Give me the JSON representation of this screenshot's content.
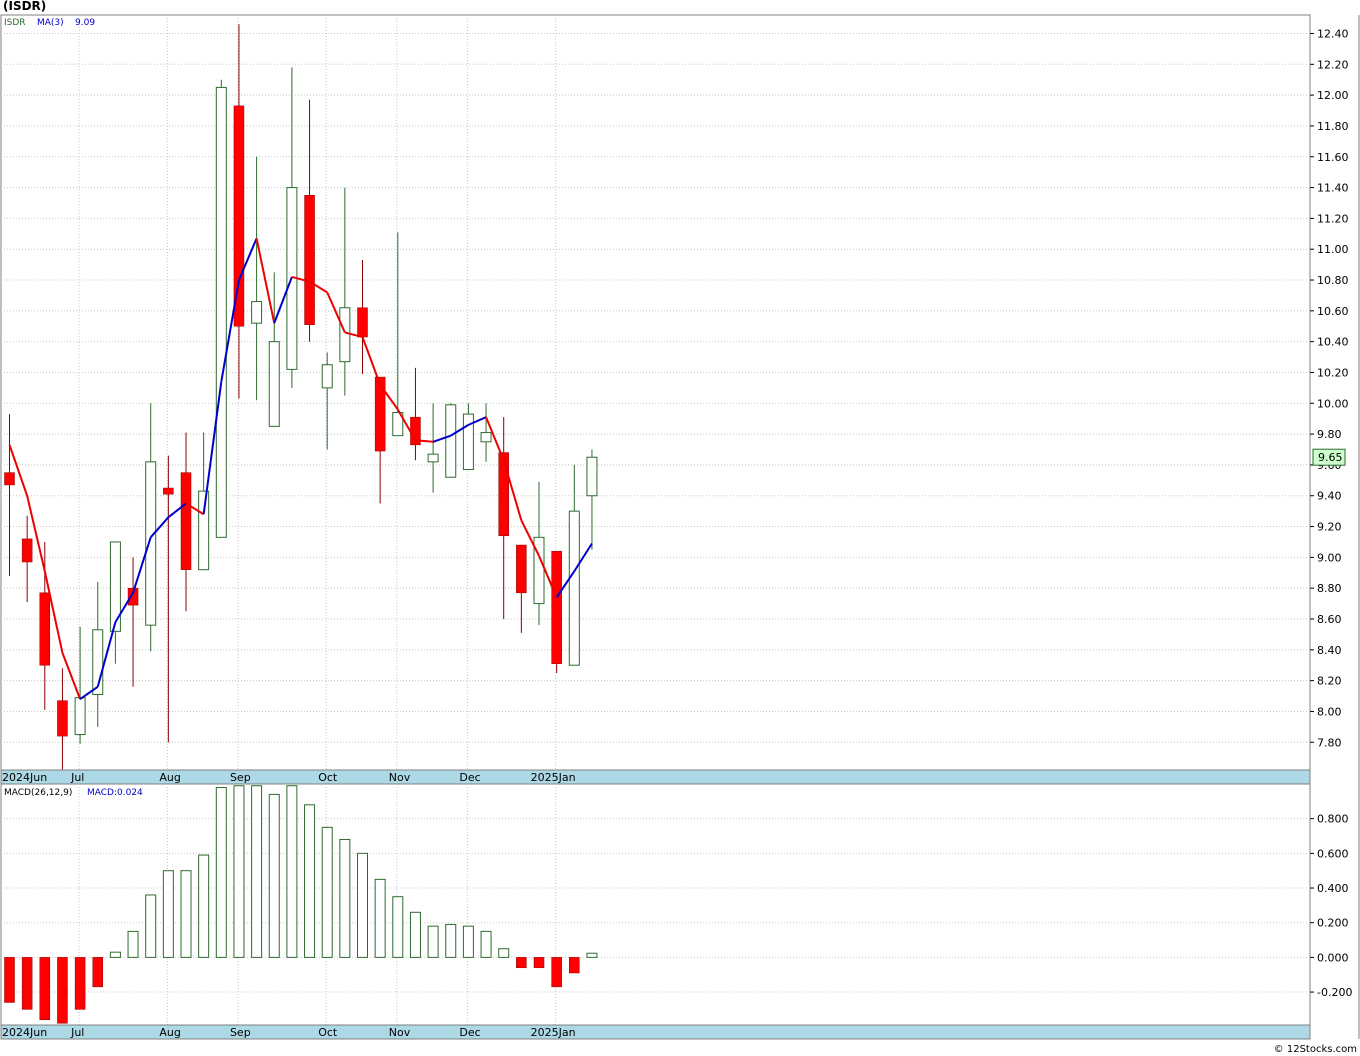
{
  "header": {
    "title": "(ISDR)"
  },
  "price_panel": {
    "symbol": "ISDR",
    "ma_label": "MA(3)",
    "ma_value": "9.09",
    "last_price_label": "9.65",
    "last_price": 9.65,
    "y_ticks": [
      "7.80",
      "8.00",
      "8.20",
      "8.40",
      "8.60",
      "8.80",
      "9.00",
      "9.20",
      "9.40",
      "9.60",
      "9.80",
      "10.00",
      "10.20",
      "10.40",
      "10.60",
      "10.80",
      "11.00",
      "11.20",
      "11.40",
      "11.60",
      "11.80",
      "12.00",
      "12.20",
      "12.40"
    ]
  },
  "macd_panel": {
    "label": "MACD(26,12,9)",
    "value_label": "MACD:0.024",
    "y_ticks": [
      "-0.200",
      "0.000",
      "0.200",
      "0.400",
      "0.600",
      "0.800"
    ]
  },
  "month_axis": {
    "labels": [
      {
        "text": "2024Jun",
        "week": 0
      },
      {
        "text": "Jul",
        "week": 4
      },
      {
        "text": "Aug",
        "week": 9
      },
      {
        "text": "Sep",
        "week": 13
      },
      {
        "text": "Oct",
        "week": 18
      },
      {
        "text": "Nov",
        "week": 22
      },
      {
        "text": "Dec",
        "week": 26
      },
      {
        "text": "2025Jan",
        "week": 31
      }
    ]
  },
  "footer": {
    "credit": "© 12Stocks.com"
  },
  "colors": {
    "up_candle": "#2e6b2e",
    "down_candle": "#ff0000",
    "ma_up": "#0000cc",
    "ma_down": "#ee0000",
    "axis_band": "#add8e6",
    "grid": "#c8c8c8",
    "last_price_bg": "#ccffcc"
  },
  "chart_data": {
    "type": "candlestick",
    "interval": "weekly",
    "price_ylim": [
      7.62,
      12.52
    ],
    "macd_ylim": [
      -0.39,
      1.0
    ],
    "candles": [
      {
        "o": 9.55,
        "h": 9.93,
        "l": 8.88,
        "c": 9.47
      },
      {
        "o": 9.12,
        "h": 9.27,
        "l": 8.71,
        "c": 8.97
      },
      {
        "o": 8.77,
        "h": 9.1,
        "l": 8.01,
        "c": 8.3
      },
      {
        "o": 8.07,
        "h": 8.28,
        "l": 7.62,
        "c": 7.84
      },
      {
        "o": 7.85,
        "h": 8.55,
        "l": 7.79,
        "c": 8.09
      },
      {
        "o": 8.11,
        "h": 8.84,
        "l": 7.9,
        "c": 8.53
      },
      {
        "o": 8.52,
        "h": 9.06,
        "l": 8.31,
        "c": 9.1
      },
      {
        "o": 8.8,
        "h": 9.0,
        "l": 8.16,
        "c": 8.69
      },
      {
        "o": 8.56,
        "h": 10.0,
        "l": 8.39,
        "c": 9.62
      },
      {
        "o": 9.45,
        "h": 9.66,
        "l": 7.8,
        "c": 9.41
      },
      {
        "o": 9.55,
        "h": 9.81,
        "l": 8.65,
        "c": 8.92
      },
      {
        "o": 8.92,
        "h": 9.81,
        "l": 8.92,
        "c": 9.43
      },
      {
        "o": 9.13,
        "h": 12.1,
        "l": 9.13,
        "c": 12.05
      },
      {
        "o": 11.93,
        "h": 12.46,
        "l": 10.03,
        "c": 10.5
      },
      {
        "o": 10.52,
        "h": 11.6,
        "l": 10.02,
        "c": 10.66
      },
      {
        "o": 9.85,
        "h": 10.85,
        "l": 9.85,
        "c": 10.4
      },
      {
        "o": 10.22,
        "h": 12.18,
        "l": 10.1,
        "c": 11.4
      },
      {
        "o": 11.35,
        "h": 11.97,
        "l": 10.4,
        "c": 10.51
      },
      {
        "o": 10.1,
        "h": 10.33,
        "l": 9.7,
        "c": 10.25
      },
      {
        "o": 10.27,
        "h": 11.4,
        "l": 10.05,
        "c": 10.62
      },
      {
        "o": 10.62,
        "h": 10.93,
        "l": 10.19,
        "c": 10.43
      },
      {
        "o": 10.17,
        "h": 10.17,
        "l": 9.35,
        "c": 9.69
      },
      {
        "o": 9.79,
        "h": 11.11,
        "l": 9.79,
        "c": 9.94
      },
      {
        "o": 9.91,
        "h": 10.23,
        "l": 9.63,
        "c": 9.73
      },
      {
        "o": 9.62,
        "h": 10.0,
        "l": 9.42,
        "c": 9.67
      },
      {
        "o": 9.52,
        "h": 10.0,
        "l": 9.52,
        "c": 9.99
      },
      {
        "o": 9.57,
        "h": 10.0,
        "l": 9.57,
        "c": 9.93
      },
      {
        "o": 9.75,
        "h": 10.0,
        "l": 9.62,
        "c": 9.81
      },
      {
        "o": 9.68,
        "h": 9.91,
        "l": 8.6,
        "c": 9.14
      },
      {
        "o": 9.08,
        "h": 9.08,
        "l": 8.51,
        "c": 8.77
      },
      {
        "o": 8.7,
        "h": 9.49,
        "l": 8.56,
        "c": 9.13
      },
      {
        "o": 9.04,
        "h": 9.04,
        "l": 8.25,
        "c": 8.31
      },
      {
        "o": 8.3,
        "h": 9.6,
        "l": 8.3,
        "c": 9.3
      },
      {
        "o": 9.4,
        "h": 9.7,
        "l": 9.05,
        "c": 9.65
      }
    ],
    "ma3": [
      9.73,
      9.4,
      8.91,
      8.38,
      8.08,
      8.16,
      8.58,
      8.77,
      9.13,
      9.26,
      9.35,
      9.28,
      10.14,
      10.8,
      11.07,
      10.52,
      10.82,
      10.79,
      10.72,
      10.46,
      10.43,
      10.12,
      9.96,
      9.76,
      9.75,
      9.79,
      9.86,
      9.91,
      9.63,
      9.24,
      9.01,
      8.74,
      8.91,
      9.09
    ],
    "macd_hist": [
      -0.26,
      -0.3,
      -0.36,
      -0.38,
      -0.3,
      -0.17,
      0.03,
      0.15,
      0.36,
      0.5,
      0.5,
      0.59,
      0.98,
      0.99,
      0.99,
      0.94,
      0.99,
      0.88,
      0.75,
      0.68,
      0.6,
      0.45,
      0.35,
      0.26,
      0.18,
      0.19,
      0.18,
      0.15,
      0.05,
      -0.06,
      -0.06,
      -0.17,
      -0.09,
      0.024
    ]
  }
}
